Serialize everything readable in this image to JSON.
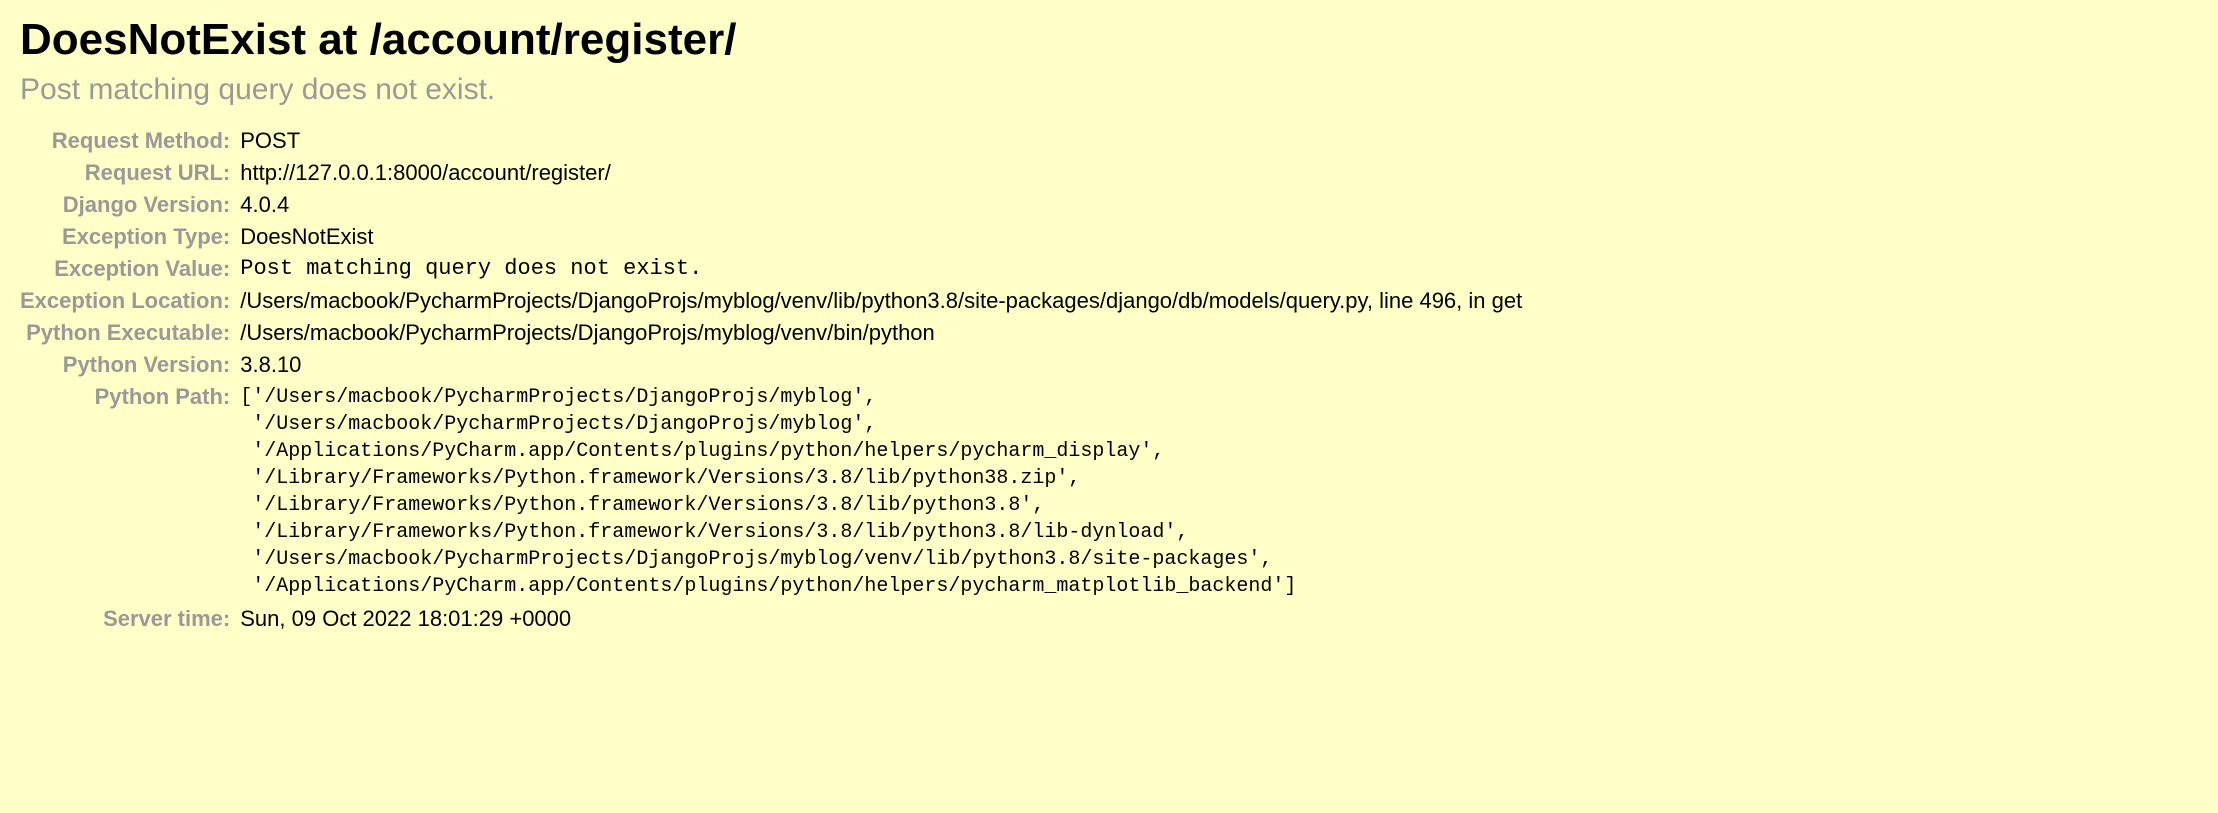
{
  "header": {
    "title": "DoesNotExist at /account/register/",
    "subtitle": "Post matching query does not exist."
  },
  "meta": {
    "request_method_label": "Request Method:",
    "request_method_value": "POST",
    "request_url_label": "Request URL:",
    "request_url_value": "http://127.0.0.1:8000/account/register/",
    "django_version_label": "Django Version:",
    "django_version_value": "4.0.4",
    "exception_type_label": "Exception Type:",
    "exception_type_value": "DoesNotExist",
    "exception_value_label": "Exception Value:",
    "exception_value_value": "Post matching query does not exist.",
    "exception_location_label": "Exception Location:",
    "exception_location_value": "/Users/macbook/PycharmProjects/DjangoProjs/myblog/venv/lib/python3.8/site-packages/django/db/models/query.py, line 496, in get",
    "python_executable_label": "Python Executable:",
    "python_executable_value": "/Users/macbook/PycharmProjects/DjangoProjs/myblog/venv/bin/python",
    "python_version_label": "Python Version:",
    "python_version_value": "3.8.10",
    "python_path_label": "Python Path:",
    "python_path_value": "['/Users/macbook/PycharmProjects/DjangoProjs/myblog',\n '/Users/macbook/PycharmProjects/DjangoProjs/myblog',\n '/Applications/PyCharm.app/Contents/plugins/python/helpers/pycharm_display',\n '/Library/Frameworks/Python.framework/Versions/3.8/lib/python38.zip',\n '/Library/Frameworks/Python.framework/Versions/3.8/lib/python3.8',\n '/Library/Frameworks/Python.framework/Versions/3.8/lib/python3.8/lib-dynload',\n '/Users/macbook/PycharmProjects/DjangoProjs/myblog/venv/lib/python3.8/site-packages',\n '/Applications/PyCharm.app/Contents/plugins/python/helpers/pycharm_matplotlib_backend']",
    "server_time_label": "Server time:",
    "server_time_value": "Sun, 09 Oct 2022 18:01:29 +0000"
  }
}
